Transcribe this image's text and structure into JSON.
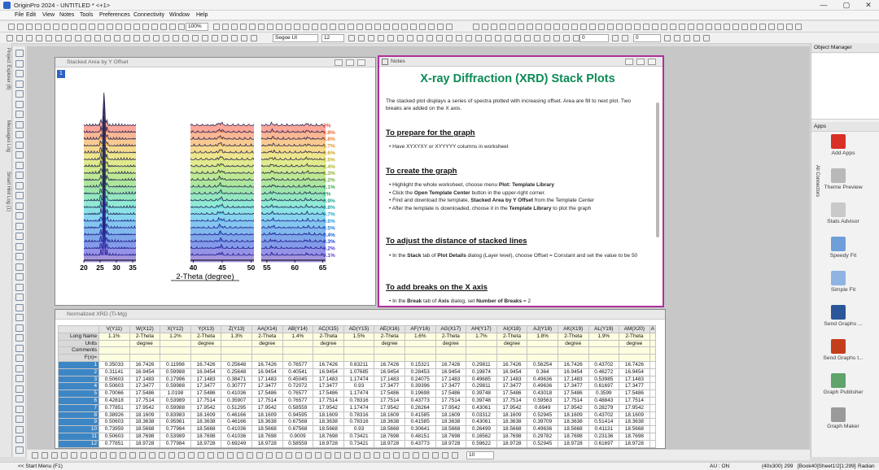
{
  "window": {
    "title": "OriginPro 2024 - UNTITLED * <+1>",
    "min": "—",
    "max": "▢",
    "close": "✕"
  },
  "menu": [
    "File",
    "Edit",
    "View",
    "Notes",
    "Tools",
    "Preferences",
    "Connectivity",
    "Window",
    "Help"
  ],
  "toolbar": {
    "zoom": "100%",
    "font": "Segoe UI",
    "font_size": "12",
    "width_box": "0",
    "line_box": "0"
  },
  "left_tabs": [
    "Project Explorer (8)",
    "Messages Log",
    "Smart Hint Log (1)"
  ],
  "graph_window": {
    "title": "Stacked Area by Y Offset",
    "layer_badge": "1",
    "chart_data": {
      "type": "area",
      "xlabel": "2-Theta (degree)",
      "x_ticks": [
        [
          "20",
          "25",
          "30",
          "35"
        ],
        [
          "40",
          "45",
          "50"
        ],
        [
          "55",
          "60",
          "65"
        ]
      ],
      "series": [
        "0.1%",
        "0.2%",
        "0.3%",
        "0.4%",
        "0.5%",
        "0.6%",
        "0.7%",
        "0.8%",
        "0.9%",
        "1%",
        "1.1%",
        "1.2%",
        "1.3%",
        "1.4%",
        "1.5%",
        "1.6%",
        "1.7%",
        "1.8%",
        "1.9%",
        "2%"
      ],
      "colors": [
        "#5b3fc4",
        "#3d3ad6",
        "#1f49d9",
        "#185fdb",
        "#1a7de0",
        "#1f98e4",
        "#26b3e2",
        "#2dcbd3",
        "#35d9b2",
        "#3ed48c",
        "#4fd06a",
        "#6bd24d",
        "#8ad53c",
        "#abd833",
        "#c8d930",
        "#e0d22f",
        "#ecbb31",
        "#f39d36",
        "#f57c3c",
        "#f55c45"
      ],
      "label_colors": [
        "#5b3fc4",
        "#3d3ad6",
        "#1f49d9",
        "#185fdb",
        "#1a7de0",
        "#1f98e4",
        "#1aa5cc",
        "#17a8b0",
        "#1aa88b",
        "#23a76a",
        "#3da84c",
        "#6ab13a",
        "#8cb52a",
        "#a9b51e",
        "#c4b41c",
        "#d2a51c",
        "#e49324",
        "#ec7d2a",
        "#ef6433",
        "#ee4b3c"
      ]
    }
  },
  "notes_window": {
    "title": "Notes",
    "heading": "X-ray Diffraction (XRD) Stack Plots",
    "intro": "The stacked plot displays a series of spectra plotted with increasing offset. Area are fill to next plot. Two breaks are added on the X axis.",
    "s1": {
      "title": "To prepare for the graph",
      "items": [
        "Have XYXYXY or XYYYYY columns in worksheet"
      ]
    },
    "s2": {
      "title": "To create the graph",
      "items": [
        [
          "Highlight the whole worksheet, choose menu ",
          "Plot: Template Library",
          ""
        ],
        [
          "Click the ",
          "Open Template Center",
          " button in the upper-right corner."
        ],
        [
          "Find and download the template, ",
          "Stacked Area by Y Offset",
          " from the Template Center"
        ],
        [
          "After the template is downloaded, choose it in the ",
          "Template Library",
          " to plot the graph"
        ]
      ]
    },
    "s3": {
      "title": "To adjust the distance of stacked lines",
      "items": [
        [
          "In the ",
          "Stack",
          " tab of ",
          "Plot Details",
          " dialog (Layer level), choose Offset = Constant and set the value to be 50"
        ]
      ]
    },
    "s4": {
      "title": "To add breaks on the X axis",
      "items": [
        [
          "In the ",
          "Break",
          " tab of ",
          "Axis",
          " dialog, set ",
          "Number of Breaks",
          " = 2"
        ]
      ]
    }
  },
  "worksheet": {
    "title": "Normalized XRD (Ti-Mg)",
    "columns": [
      "V(Y11)",
      "W(X12)",
      "X(Y12)",
      "Y(X13)",
      "Z(Y13)",
      "AA(X14)",
      "AB(Y14)",
      "AC(X15)",
      "AD(Y15)",
      "AE(X16)",
      "AF(Y16)",
      "AG(X17)",
      "AH(Y17)",
      "AI(X18)",
      "AJ(Y18)",
      "AK(X19)",
      "AL(Y19)",
      "AM(X20)",
      "A"
    ],
    "long_name": [
      "1.1%",
      "2-Theta",
      "1.2%",
      "2-Theta",
      "1.3%",
      "2-Theta",
      "1.4%",
      "2-Theta",
      "1.5%",
      "2-Theta",
      "1.6%",
      "2-Theta",
      "1.7%",
      "2-Theta",
      "1.8%",
      "2-Theta",
      "1.9%",
      "2-Theta",
      ""
    ],
    "units": [
      "",
      "degree",
      "",
      "degree",
      "",
      "degree",
      "",
      "degree",
      "",
      "degree",
      "",
      "degree",
      "",
      "degree",
      "",
      "degree",
      "",
      "degree",
      ""
    ],
    "meta_labels": [
      "Long Name",
      "Units",
      "Comments",
      "F(x)="
    ],
    "rows": [
      [
        "1",
        "0.35033",
        "16.7426",
        "0.11998",
        "16.7426",
        "0.25648",
        "16.7426",
        "0.76577",
        "16.7426",
        "0.83211",
        "16.7426",
        "0.15321",
        "16.7426",
        "0.29811",
        "16.7426",
        "0.56254",
        "16.7426",
        "0.43702",
        "16.7426"
      ],
      [
        "2",
        "0.31141",
        "16.9454",
        "0.59988",
        "16.9454",
        "0.25648",
        "16.9454",
        "0.40541",
        "16.9454",
        "1.07685",
        "16.9454",
        "0.28453",
        "16.9454",
        "0.19874",
        "16.9454",
        "0.364",
        "16.9454",
        "0.46272",
        "16.9454"
      ],
      [
        "3",
        "0.50603",
        "17.1483",
        "0.17996",
        "17.1483",
        "0.38471",
        "17.1483",
        "0.45045",
        "17.1483",
        "1.17474",
        "17.1483",
        "0.24075",
        "17.1483",
        "0.49685",
        "17.1483",
        "0.49636",
        "17.1483",
        "0.53985",
        "17.1483"
      ],
      [
        "4",
        "0.50603",
        "17.3477",
        "0.59988",
        "17.3477",
        "0.30777",
        "17.3477",
        "0.72072",
        "17.3477",
        "0.93",
        "17.3477",
        "0.39396",
        "17.3477",
        "0.29811",
        "17.3477",
        "0.49636",
        "17.3477",
        "0.61697",
        "17.3477"
      ],
      [
        "5",
        "0.70066",
        "17.5486",
        "1.0198",
        "17.5486",
        "0.41036",
        "17.5486",
        "0.76577",
        "17.5486",
        "1.17474",
        "17.5486",
        "0.19698",
        "17.5486",
        "0.39748",
        "17.5486",
        "0.43018",
        "17.5486",
        "0.3599",
        "17.5486"
      ],
      [
        "6",
        "0.42818",
        "17.7514",
        "0.53989",
        "17.7514",
        "0.35907",
        "17.7514",
        "0.76577",
        "17.7514",
        "0.78316",
        "17.7514",
        "0.43773",
        "17.7514",
        "0.39748",
        "17.7514",
        "0.59563",
        "17.7514",
        "0.48843",
        "17.7514"
      ],
      [
        "7",
        "0.77851",
        "17.9542",
        "0.59988",
        "17.9542",
        "0.51295",
        "17.9542",
        "0.58559",
        "17.9542",
        "1.17474",
        "17.9542",
        "0.26264",
        "17.9542",
        "0.43061",
        "17.9542",
        "0.6949",
        "17.9542",
        "0.28279",
        "17.9542"
      ],
      [
        "8",
        "0.38926",
        "18.1609",
        "0.83983",
        "18.1609",
        "0.46166",
        "18.1609",
        "0.94595",
        "18.1609",
        "0.78316",
        "18.1609",
        "0.41585",
        "18.1609",
        "0.03312",
        "18.1609",
        "0.52945",
        "18.1609",
        "0.43702",
        "18.1609"
      ],
      [
        "9",
        "0.50603",
        "18.3638",
        "0.95981",
        "18.3638",
        "0.46166",
        "18.3638",
        "0.67568",
        "18.3638",
        "0.78316",
        "18.3638",
        "0.41585",
        "18.3638",
        "0.43061",
        "18.3638",
        "0.39709",
        "18.3638",
        "0.51414",
        "18.3638"
      ],
      [
        "10",
        "0.73959",
        "18.5668",
        "0.77984",
        "18.5668",
        "0.41036",
        "18.5668",
        "0.67568",
        "18.5668",
        "0.93",
        "18.5668",
        "0.30641",
        "18.5668",
        "0.26499",
        "18.5668",
        "0.49636",
        "18.5668",
        "0.41131",
        "18.5668"
      ],
      [
        "11",
        "0.50603",
        "18.7698",
        "0.53989",
        "18.7698",
        "0.41036",
        "18.7698",
        "0.9009",
        "18.7698",
        "0.73421",
        "18.7698",
        "0.48151",
        "18.7698",
        "0.16562",
        "18.7698",
        "0.29782",
        "18.7698",
        "0.23136",
        "18.7698"
      ],
      [
        "12",
        "0.77851",
        "18.9728",
        "0.77984",
        "18.9728",
        "0.69249",
        "18.9728",
        "0.58559",
        "18.9728",
        "0.73421",
        "18.9728",
        "0.43773",
        "18.9728",
        "0.59622",
        "18.9728",
        "0.52945",
        "18.9728",
        "0.61697",
        "18.9728"
      ]
    ]
  },
  "object_manager": {
    "title": "Object Manager"
  },
  "apps": {
    "title": "Apps",
    "side_tabs": "All   Connectors",
    "items": [
      {
        "label": "Add Apps",
        "color": "#d93025"
      },
      {
        "label": "Theme Preview",
        "color": "#b9b9b9"
      },
      {
        "label": "Stats Advisor",
        "color": "#c9c9c9"
      },
      {
        "label": "Speedy Fit",
        "color": "#6e9fd8"
      },
      {
        "label": "Simple Fit",
        "color": "#8fb4e4"
      },
      {
        "label": "Send Graphs ...",
        "color": "#2b579a"
      },
      {
        "label": "Send Graphs t...",
        "color": "#c43e1c"
      },
      {
        "label": "Graph Publisher",
        "color": "#5ea46b"
      },
      {
        "label": "Graph Maker",
        "color": "#9a9a9a"
      }
    ]
  },
  "bottom": {
    "sheet_tab": "10"
  },
  "status": {
    "start": "<< Start Menu (F1)",
    "au": "AU : ON",
    "dims": "(40x300) 299",
    "book": "[Book40]Sheet1!2[1:299]",
    "unit": "Radian"
  }
}
